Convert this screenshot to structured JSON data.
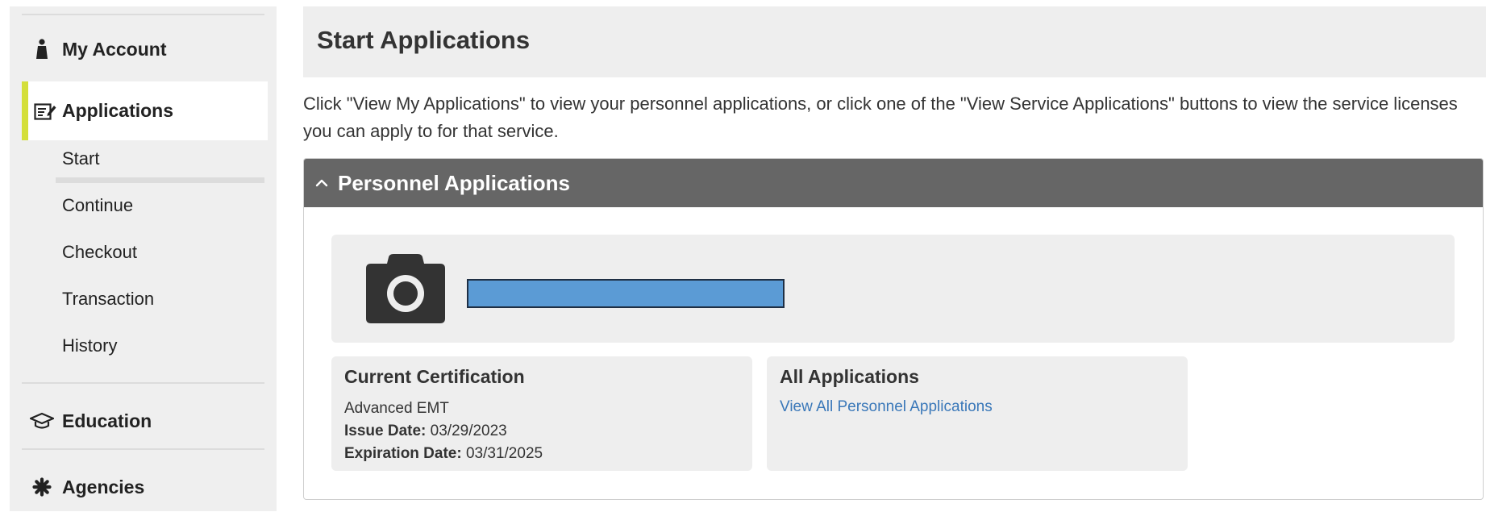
{
  "sidebar": {
    "my_account": {
      "label": "My Account",
      "icon": "person-icon"
    },
    "applications": {
      "label": "Applications",
      "icon": "edit-document-icon",
      "accent_color": "#d4df3a",
      "items": [
        {
          "label": "Start"
        },
        {
          "label": "Continue"
        },
        {
          "label": "Checkout"
        },
        {
          "label": "Transaction"
        },
        {
          "label": "History"
        }
      ]
    },
    "education": {
      "label": "Education",
      "icon": "graduation-cap-icon"
    },
    "agencies": {
      "label": "Agencies",
      "icon": "asterisk-icon"
    }
  },
  "main": {
    "title": "Start Applications",
    "intro": "Click \"View My Applications\" to view your personnel applications, or click one of the \"View Service Applications\" buttons to view the service licenses you can apply to for that service.",
    "panel": {
      "title": "Personnel Applications",
      "icon": "chevron-up-icon",
      "header_color": "#666666",
      "profile": {
        "photo_icon": "camera-icon",
        "name_redaction_color": "#5b9bd5"
      },
      "current_certification": {
        "title": "Current Certification",
        "level": "Advanced EMT",
        "issue_label": "Issue Date:",
        "issue_value": "03/29/2023",
        "expiration_label": "Expiration Date:",
        "expiration_value": "03/31/2025"
      },
      "all_applications": {
        "title": "All Applications",
        "link_label": "View All Personnel Applications",
        "link_color": "#3a78b9"
      }
    }
  }
}
